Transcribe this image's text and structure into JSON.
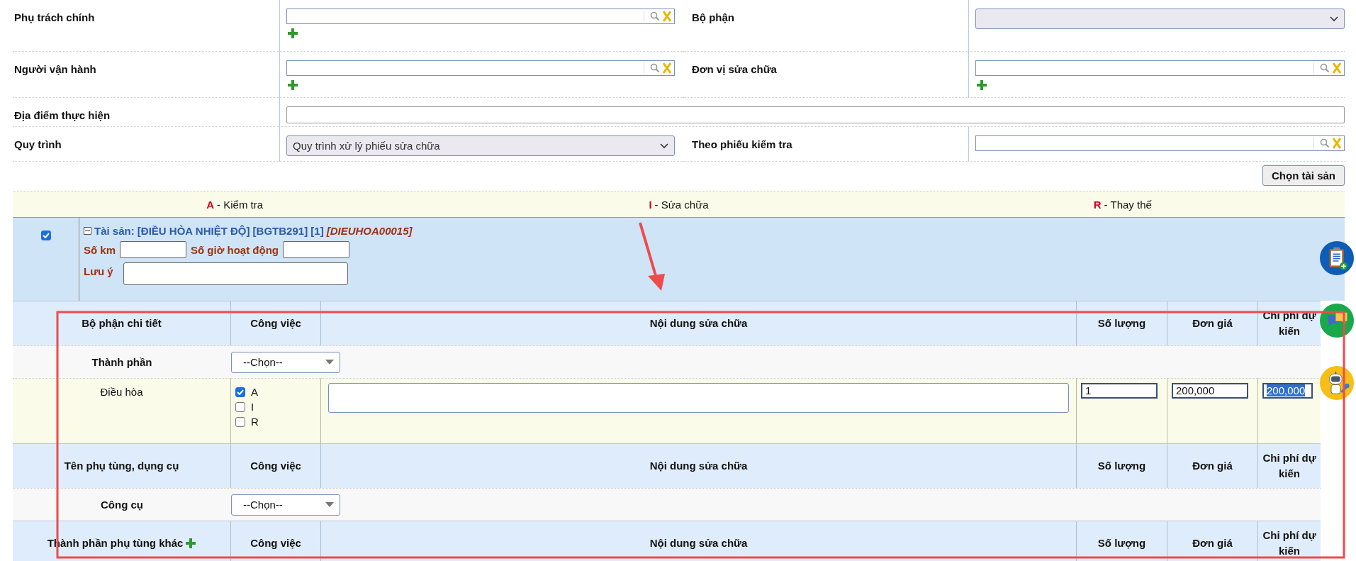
{
  "form": [
    {
      "cells": [
        {
          "label": "Phụ trách chính",
          "kind": "lookup",
          "add": true
        },
        {
          "label": "Bộ phận",
          "kind": "select"
        }
      ]
    },
    {
      "cells": [
        {
          "label": "Người vận hành",
          "kind": "lookup",
          "add": true
        },
        {
          "label": "Đơn vị sửa chữa",
          "kind": "lookup",
          "add": true
        }
      ]
    },
    {
      "cells": [
        {
          "label": "Địa điểm thực hiện",
          "kind": "text"
        }
      ]
    },
    {
      "cells": [
        {
          "label": "Quy trình",
          "kind": "select",
          "value": "Quy trình xử lý phiếu sửa chữa"
        },
        {
          "label": "Theo phiếu kiểm tra",
          "kind": "lookup",
          "add": false
        }
      ]
    }
  ],
  "choose_button": "Chọn tài sản",
  "legend": [
    {
      "code": "A",
      "text": "- Kiểm tra"
    },
    {
      "code": "I",
      "text": "- Sửa chữa"
    },
    {
      "code": "R",
      "text": "- Thay thế"
    }
  ],
  "asset": {
    "checked": true,
    "expanded": true,
    "title": "Tài sản: [ĐIỀU HÒA NHIỆT ĐỘ] [BGTB291] [1]",
    "code": "[DIEUHOA00015]",
    "fields": [
      {
        "label": "Số km"
      },
      {
        "label": "Số giờ hoạt động"
      }
    ],
    "note_label": "Lưu ý"
  },
  "sections": [
    {
      "columns": [
        "Bộ phận chi tiết",
        "Công việc",
        "Nội dung sửa chữa",
        "Số lượng",
        "Đơn giá",
        "Chi phí dự kiến"
      ],
      "add": false,
      "picker": {
        "label": "Thành phần",
        "value": "--Chọn--"
      },
      "items": [
        {
          "name": "Điều hòa",
          "tasks": [
            {
              "code": "A",
              "checked": true
            },
            {
              "code": "I",
              "checked": false
            },
            {
              "code": "R",
              "checked": false
            }
          ],
          "quantity": "1",
          "unit_price": "200,000",
          "cost": "200,000",
          "cost_selected": true
        }
      ]
    },
    {
      "columns": [
        "Tên phụ tùng, dụng cụ",
        "Công việc",
        "Nội dung sửa chữa",
        "Số lượng",
        "Đơn giá",
        "Chi phí dự kiến"
      ],
      "add": false,
      "picker": {
        "label": "Công cụ",
        "value": "--Chọn--"
      }
    },
    {
      "columns": [
        "Thành phần phụ tùng khác",
        "Công việc",
        "Nội dung sửa chữa",
        "Số lượng",
        "Đơn giá",
        "Chi phí dự kiến"
      ],
      "add": true
    }
  ]
}
